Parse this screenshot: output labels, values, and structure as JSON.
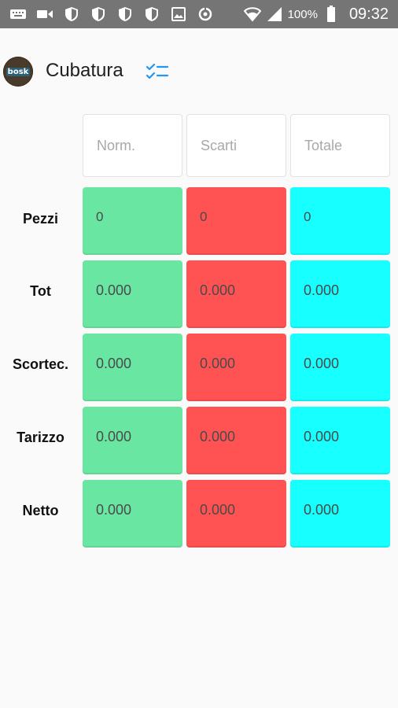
{
  "status_bar": {
    "icons_left": [
      "keyboard-icon",
      "video-icon",
      "shield-icon",
      "shield-icon",
      "shield-icon",
      "shield-icon",
      "image-icon",
      "sync-icon"
    ],
    "icons_right": [
      "wifi-icon",
      "signal-icon",
      "battery-icon"
    ],
    "battery": "100%",
    "time": "09:32"
  },
  "appbar": {
    "logo_text": "bosk",
    "title": "Cubatura",
    "action_icon": "checklist-icon"
  },
  "table": {
    "columns": [
      "Norm.",
      "Scarti",
      "Totale"
    ],
    "column_colors": [
      "#6ae6a3",
      "#ff5252",
      "#18ffff"
    ],
    "rows": [
      {
        "label": "Pezzi",
        "values": [
          "0",
          "0",
          "0"
        ]
      },
      {
        "label": "Tot",
        "values": [
          "0.000",
          "0.000",
          "0.000"
        ]
      },
      {
        "label": "Scortec.",
        "values": [
          "0.000",
          "0.000",
          "0.000"
        ]
      },
      {
        "label": "Tarizzo",
        "values": [
          "0.000",
          "0.000",
          "0.000"
        ]
      },
      {
        "label": "Netto",
        "values": [
          "0.000",
          "0.000",
          "0.000"
        ]
      }
    ]
  }
}
